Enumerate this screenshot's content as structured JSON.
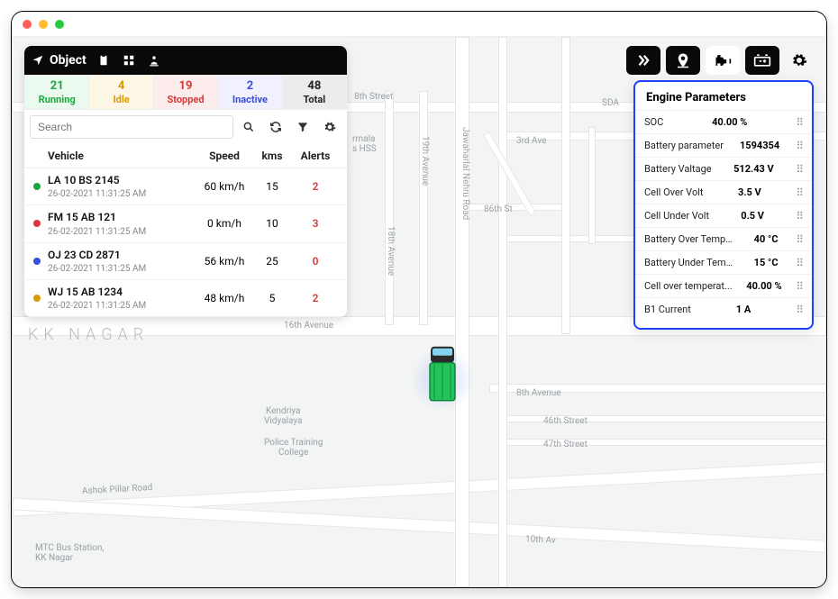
{
  "window": {
    "title": ""
  },
  "toolbar_right": {
    "items": [
      {
        "id": "expand",
        "icon": "chevrons-right"
      },
      {
        "id": "location",
        "icon": "map-pin"
      },
      {
        "id": "engine",
        "icon": "engine",
        "active": true
      },
      {
        "id": "battery",
        "icon": "battery"
      }
    ],
    "settings_icon": "gear"
  },
  "object_panel": {
    "title": "Object",
    "header_icons": [
      "clipboard",
      "grid",
      "person-pin"
    ],
    "status": {
      "running": {
        "count": "21",
        "label": "Running"
      },
      "idle": {
        "count": "4",
        "label": "Idle"
      },
      "stopped": {
        "count": "19",
        "label": "Stopped"
      },
      "inactive": {
        "count": "2",
        "label": "Inactive"
      },
      "total": {
        "count": "48",
        "label": "Total"
      }
    },
    "search": {
      "placeholder": "Search"
    },
    "columns": {
      "vehicle": "Vehicle",
      "speed": "Speed",
      "kms": "kms",
      "alerts": "Alerts"
    },
    "rows": [
      {
        "color": "#1fa53f",
        "name": "LA 10 BS 2145",
        "ts": "26-02-2021 11:31:25 AM",
        "speed": "60 km/h",
        "kms": "15",
        "alerts": "2"
      },
      {
        "color": "#d93838",
        "name": "FM 15 AB 121",
        "ts": "26-02-2021 11:31:25 AM",
        "speed": "0 km/h",
        "kms": "10",
        "alerts": "3"
      },
      {
        "color": "#3b4fd6",
        "name": "OJ 23 CD 2871",
        "ts": "26-02-2021 11:31:25 AM",
        "speed": "56 km/h",
        "kms": "25",
        "alerts": "0"
      },
      {
        "color": "#d89a00",
        "name": "WJ 15 AB 1234",
        "ts": "26-02-2021 11:31:25 AM",
        "speed": "48 km/h",
        "kms": "5",
        "alerts": "2"
      }
    ]
  },
  "engine_panel": {
    "title": "Engine Parameters",
    "rows": [
      {
        "label": "SOC",
        "value": "40.00 %"
      },
      {
        "label": "Battery parameter",
        "value": "1594354"
      },
      {
        "label": "Battery Valtage",
        "value": "512.43 V"
      },
      {
        "label": "Cell Over Volt",
        "value": "3.5 V"
      },
      {
        "label": "Cell Under Volt",
        "value": "0.5 V"
      },
      {
        "label": "Battery Over Temper...",
        "value": "40 °C"
      },
      {
        "label": "Battery Under Temp...",
        "value": "15 °C"
      },
      {
        "label": "Cell over temperat...",
        "value": "40.00 %"
      },
      {
        "label": "B1 Current",
        "value": "1 A"
      }
    ]
  },
  "map": {
    "area": "KK NAGAR",
    "labels": {
      "eighth_st": "8th Street",
      "sixteenth_av": "16th Avenue",
      "ashok": "Ashok Pillar Road",
      "tenth_av": "10th Av",
      "third_av": "3rd Ave",
      "eighth_av": "8th Avenue",
      "fortysixth_st": "46th Street",
      "fortyseventh_st": "47th Street",
      "eightysixth_st": "86th St",
      "jn_road": "Jawaharlal Nehru Road",
      "eighteenth_av": "18th Avenue",
      "nineteenth_av": "19th Avenue"
    },
    "pois": {
      "kv": "Kendriya\nVidyalaya",
      "ptc": "Police Training\nCollege",
      "mtc": "MTC Bus Station,\nKK Nagar",
      "hss": "rmala\ns HSS",
      "sda": "SDA"
    }
  }
}
